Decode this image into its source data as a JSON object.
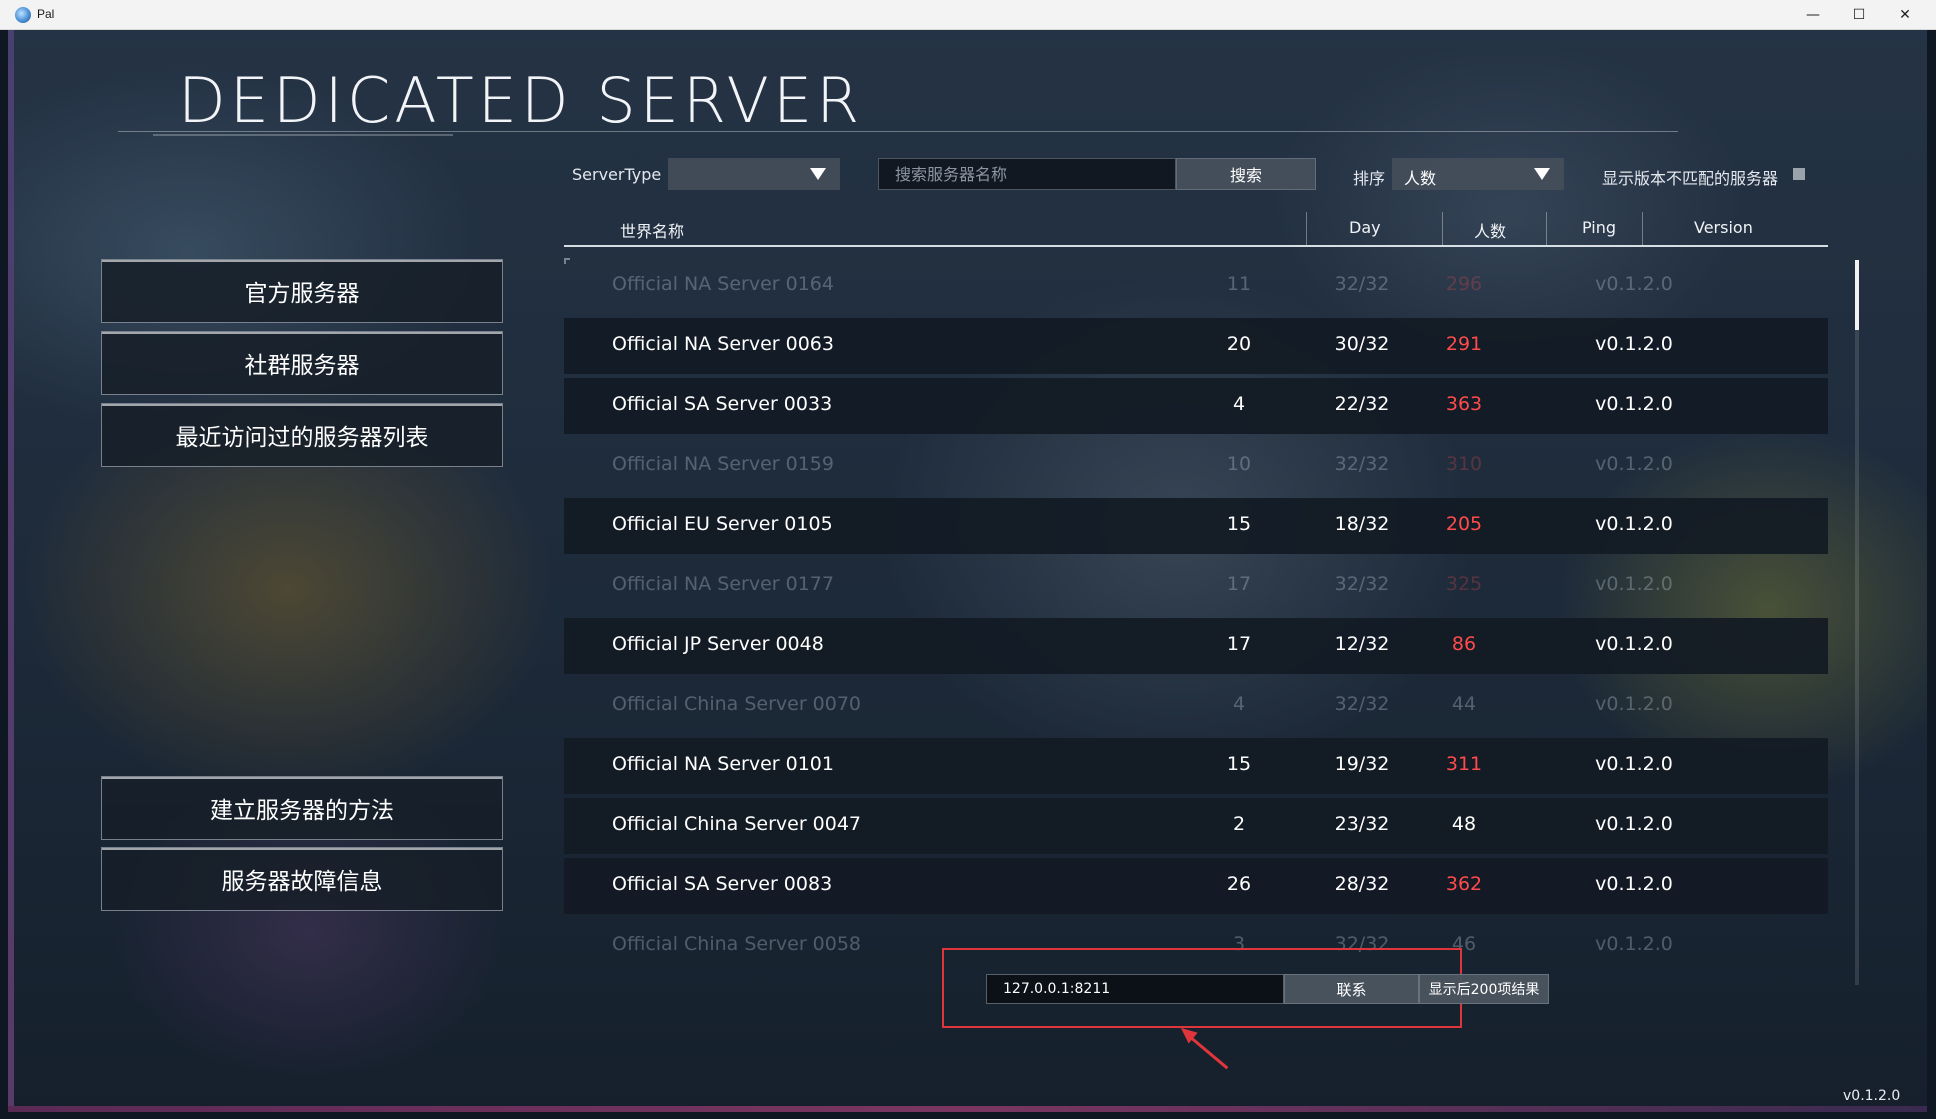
{
  "window": {
    "title": "Pal",
    "minimize": "—",
    "maximize": "☐",
    "close": "✕"
  },
  "header": {
    "title": "DEDICATED SERVER"
  },
  "menu": {
    "items": [
      "官方服务器",
      "社群服务器",
      "最近访问过的服务器列表"
    ],
    "bottom_items": [
      "建立服务器的方法",
      "服务器故障信息"
    ]
  },
  "filters": {
    "server_type_label": "ServerType",
    "server_type_value": "",
    "search_placeholder": "搜索服务器名称",
    "search_button": "搜索",
    "sort_label": "排序",
    "sort_value": "人数",
    "show_mismatch_label": "显示版本不匹配的服务器",
    "show_mismatch_checked": false
  },
  "table": {
    "columns": [
      "世界名称",
      "Day",
      "人数",
      "Ping",
      "Version"
    ],
    "rows": [
      {
        "name": "Official NA Server 0164",
        "day": "11",
        "players": "32/32",
        "ping": "296",
        "version": "v0.1.2.0",
        "full": true,
        "high_ping": true
      },
      {
        "name": "Official NA Server 0063",
        "day": "20",
        "players": "30/32",
        "ping": "291",
        "version": "v0.1.2.0",
        "full": false,
        "high_ping": true
      },
      {
        "name": "Official SA Server 0033",
        "day": "4",
        "players": "22/32",
        "ping": "363",
        "version": "v0.1.2.0",
        "full": false,
        "high_ping": true
      },
      {
        "name": "Official NA Server 0159",
        "day": "10",
        "players": "32/32",
        "ping": "310",
        "version": "v0.1.2.0",
        "full": true,
        "high_ping": true
      },
      {
        "name": "Official EU Server 0105",
        "day": "15",
        "players": "18/32",
        "ping": "205",
        "version": "v0.1.2.0",
        "full": false,
        "high_ping": true
      },
      {
        "name": "Official NA Server 0177",
        "day": "17",
        "players": "32/32",
        "ping": "325",
        "version": "v0.1.2.0",
        "full": true,
        "high_ping": true
      },
      {
        "name": "Official JP Server 0048",
        "day": "17",
        "players": "12/32",
        "ping": "86",
        "version": "v0.1.2.0",
        "full": false,
        "high_ping": true
      },
      {
        "name": "Official China Server 0070",
        "day": "4",
        "players": "32/32",
        "ping": "44",
        "version": "v0.1.2.0",
        "full": true,
        "high_ping": false
      },
      {
        "name": "Official NA Server 0101",
        "day": "15",
        "players": "19/32",
        "ping": "311",
        "version": "v0.1.2.0",
        "full": false,
        "high_ping": true
      },
      {
        "name": "Official China Server 0047",
        "day": "2",
        "players": "23/32",
        "ping": "48",
        "version": "v0.1.2.0",
        "full": false,
        "high_ping": false
      },
      {
        "name": "Official SA Server 0083",
        "day": "26",
        "players": "28/32",
        "ping": "362",
        "version": "v0.1.2.0",
        "full": false,
        "high_ping": true
      },
      {
        "name": "Official China Server 0058",
        "day": "3",
        "players": "32/32",
        "ping": "46",
        "version": "v0.1.2.0",
        "full": true,
        "high_ping": false
      }
    ]
  },
  "connect": {
    "ip_value": "127.0.0.1:8211",
    "connect_button": "联系",
    "more_button": "显示后200项结果"
  },
  "footer": {
    "version": "v0.1.2.0"
  },
  "colors": {
    "high_ping": "#ff4b4b",
    "highlight_box": "#e0353b"
  },
  "icons": {
    "app": "pal-app-icon",
    "dropdown": "triangle-down-icon",
    "annotation": "red-arrow-icon"
  }
}
